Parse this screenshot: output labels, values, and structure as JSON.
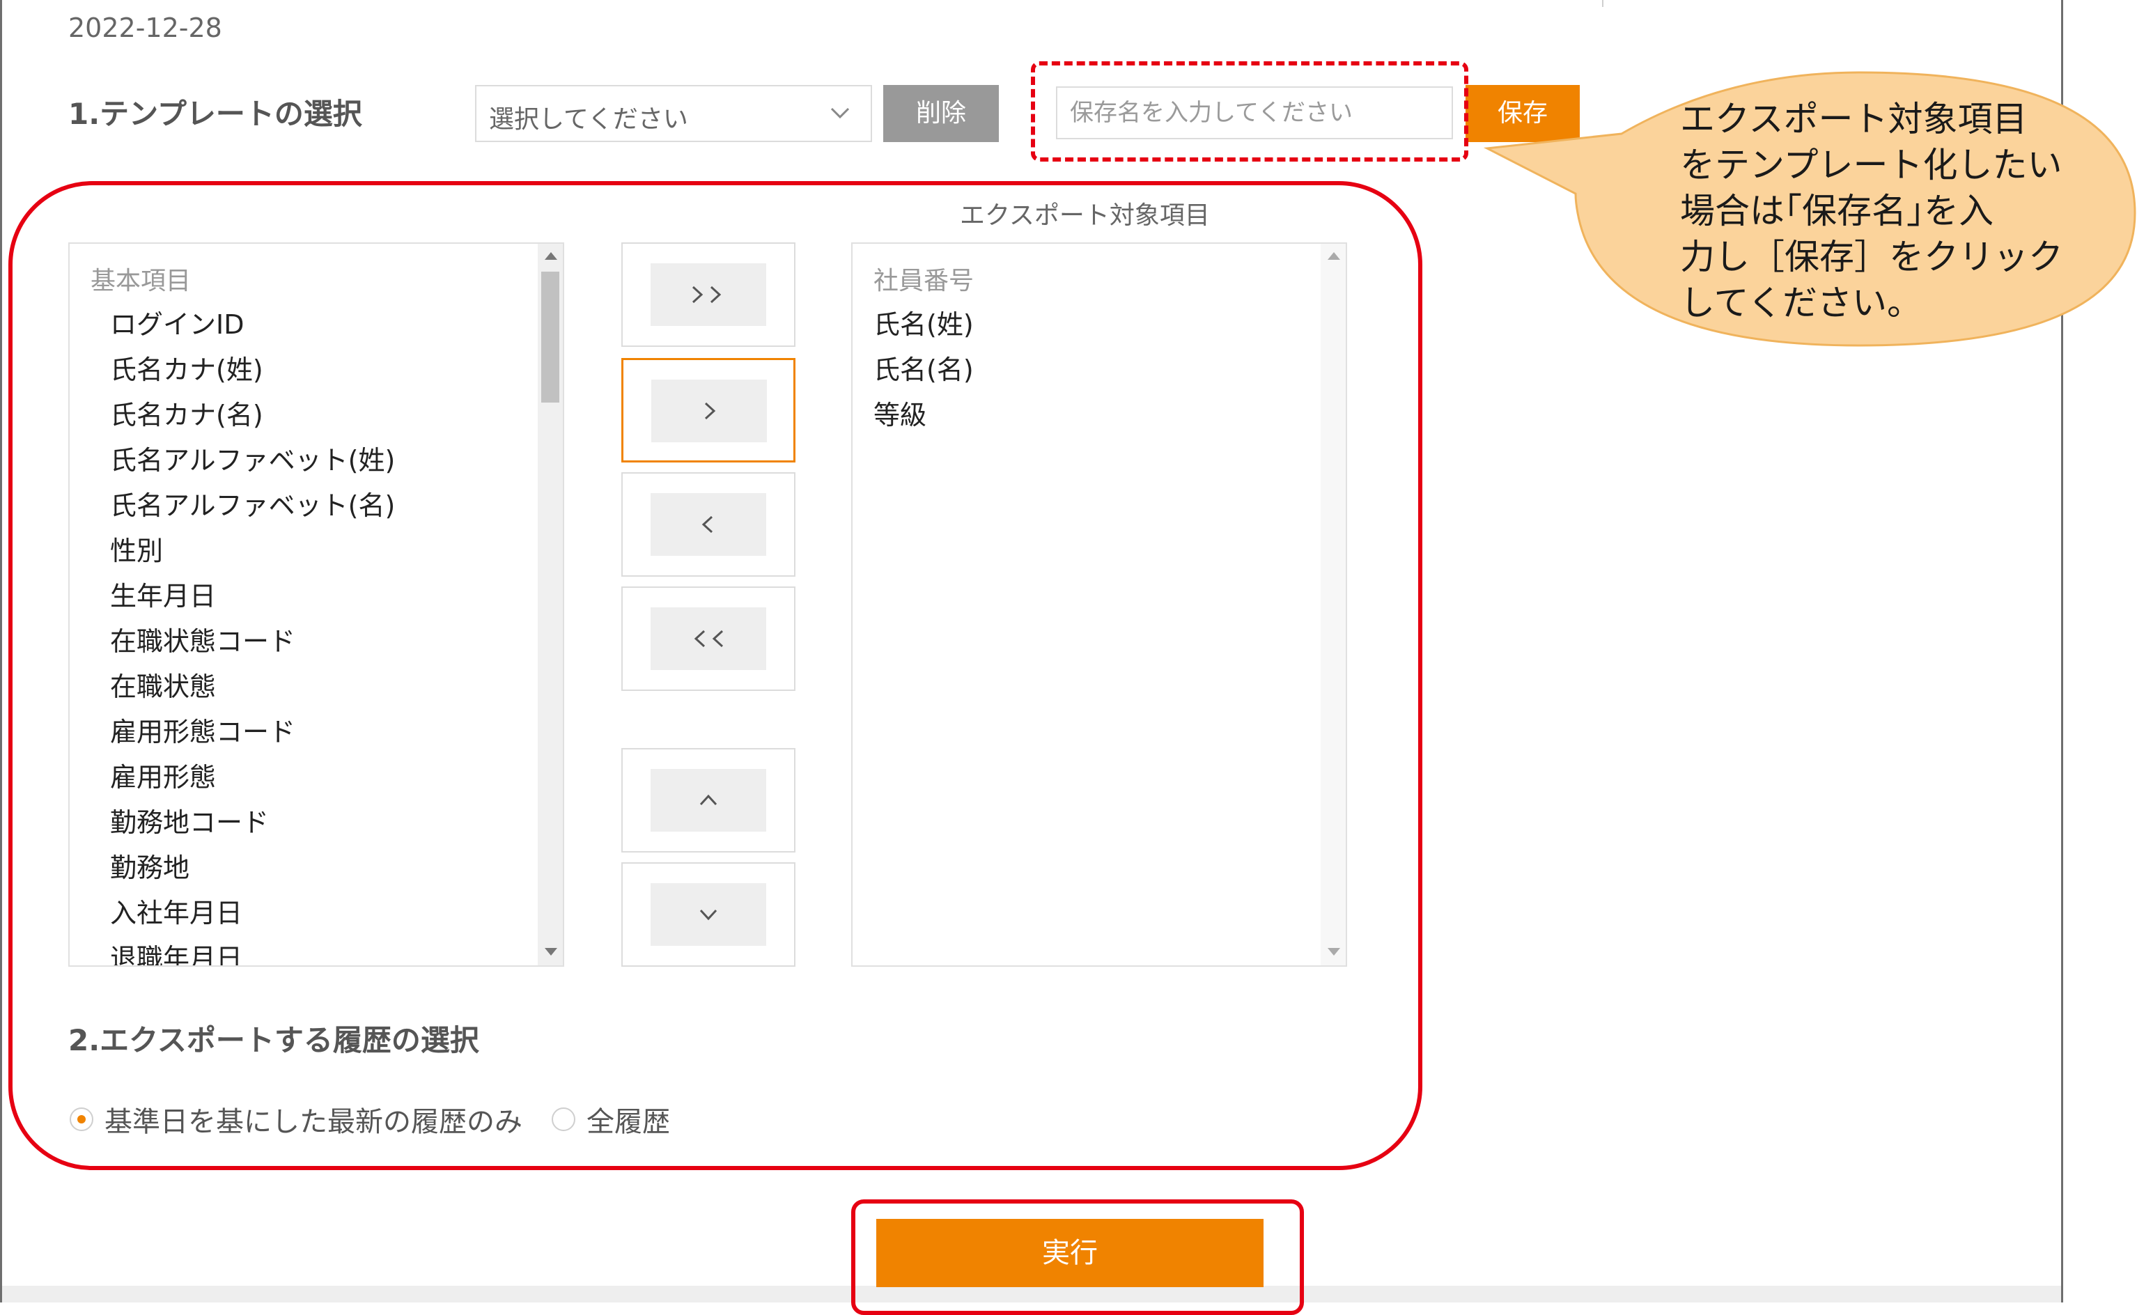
{
  "date": "2022-12-28",
  "section1": {
    "title": "1.テンプレートの選択",
    "select_placeholder": "選択してください",
    "delete_label": "削除",
    "save_name_placeholder": "保存名を入力してください",
    "save_label": "保存"
  },
  "callout": {
    "lines": [
      "エクスポート対象項目",
      "をテンプレート化したい",
      "場合は｢保存名｣を入",
      "力し［保存］をクリック",
      "してください。"
    ]
  },
  "export_items_label": "エクスポート対象項目",
  "left_list": {
    "header": "基本項目",
    "items": [
      "ログインID",
      "氏名カナ(姓)",
      "氏名カナ(名)",
      "氏名アルファベット(姓)",
      "氏名アルファベット(名)",
      "性別",
      "生年月日",
      "在職状態コード",
      "在職状態",
      "雇用形態コード",
      "雇用形態",
      "勤務地コード",
      "勤務地",
      "入社年月日",
      "退職年月日"
    ]
  },
  "right_list": {
    "header": "社員番号",
    "items": [
      "氏名(姓)",
      "氏名(名)",
      "等級"
    ]
  },
  "move_buttons": {
    "all_right": ">>",
    "right": ">",
    "left": "<",
    "all_left": "<<",
    "up": "^",
    "down": "v"
  },
  "section2": {
    "title": "2.エクスポートする履歴の選択",
    "option_latest": "基準日を基にした最新の履歴のみ",
    "option_all": "全履歴",
    "selected": "option_latest"
  },
  "run_label": "実行",
  "colors": {
    "accent": "#f08300",
    "highlight": "#e60012",
    "callout_fill": "#fbd39b",
    "delete_button": "#999999"
  }
}
